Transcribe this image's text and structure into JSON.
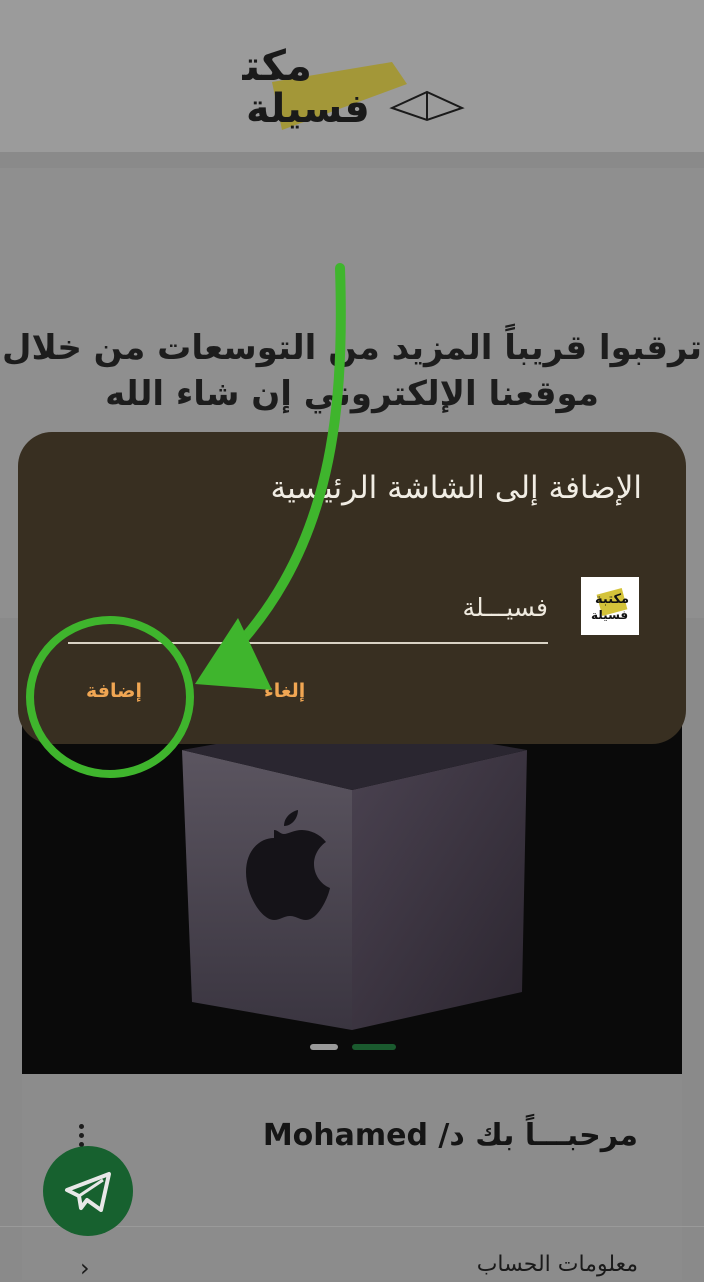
{
  "app": {
    "logo_text": "مكتبة فسيلة"
  },
  "promo": {
    "line1": "ترقبوا قريباً المزيد من التوسعات من خلال",
    "line2": "موقعنا الإلكتروني إن شاء الله"
  },
  "slider": {
    "image_icon": "apple-award-cube",
    "slide_count": 2,
    "active_slide": 2
  },
  "account": {
    "welcome": "مرحبـــاً بك د/ Mohamed",
    "info_link": "معلومات الحساب"
  },
  "dialog": {
    "title": "الإضافة إلى الشاشة الرئيسية",
    "name_value": "فسيـــلة",
    "cancel_label": "إلغاء",
    "add_label": "إضافة"
  },
  "colors": {
    "dialog_bg": "#382f21",
    "button_text": "#f0a653",
    "annotation": "#3fb52d",
    "fab": "#17612f"
  }
}
